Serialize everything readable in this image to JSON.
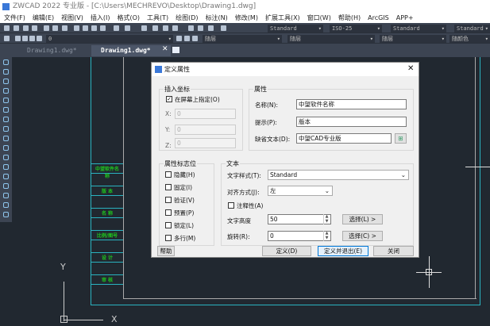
{
  "window": {
    "title": "ZWCAD 2022 专业版 - [C:\\Users\\MECHREVO\\Desktop\\Drawing1.dwg]"
  },
  "menu": [
    "文件(F)",
    "编辑(E)",
    "视图(V)",
    "插入(I)",
    "格式(O)",
    "工具(T)",
    "绘图(D)",
    "标注(N)",
    "修改(M)",
    "扩展工具(X)",
    "窗口(W)",
    "帮助(H)",
    "ArcGIS",
    "APP+"
  ],
  "toolbar": {
    "text_style": "Standard",
    "dim_style": "ISO-25",
    "table_style": "Standard",
    "multileader_style": "Standard",
    "layer": "0",
    "color": "随层",
    "linetype": "随层",
    "lineweight": "随层",
    "plotstyle": "随颜色"
  },
  "tabs": [
    {
      "label": "Drawing1.dwg*",
      "active": false
    },
    {
      "label": "Drawing1.dwg*",
      "active": true
    }
  ],
  "drawing": {
    "green_texts": [
      "中望软件名称",
      "版 本",
      "名 称",
      "比例/图号",
      "设 计",
      "审 核"
    ],
    "axis_x": "X",
    "axis_y": "Y"
  },
  "dialog": {
    "title": "定义属性",
    "insert": {
      "title": "插入坐标",
      "on_screen": "在屏幕上指定(O)",
      "on_screen_checked": true,
      "x_label": "X:",
      "x": "0",
      "y_label": "Y:",
      "y": "0",
      "z_label": "Z:",
      "z": "0"
    },
    "attr": {
      "title": "属性",
      "name_label": "名称(N):",
      "name": "中望软件名称",
      "prompt_label": "提示(P):",
      "prompt": "版本",
      "default_label": "缺省文本(D):",
      "default": "中望CAD专业版"
    },
    "flags": {
      "title": "属性标志位",
      "items": [
        "隐藏(H)",
        "固定(I)",
        "验证(V)",
        "预置(P)",
        "锁定(L)",
        "多行(M)"
      ]
    },
    "text": {
      "title": "文本",
      "style_label": "文字样式(T):",
      "style": "Standard",
      "justify_label": "对齐方式(J):",
      "justify": "左",
      "annotative": "注释性(A)",
      "height_label": "文字高度",
      "height": "50",
      "rotation_label": "旋转(R):",
      "rotation": "0",
      "pick_height": "选择(L) >",
      "pick_rotation": "选择(C) >"
    },
    "buttons": {
      "help": "帮助",
      "define": "定义(D)",
      "define_exit": "定义并退出(E)",
      "close": "关闭"
    }
  }
}
